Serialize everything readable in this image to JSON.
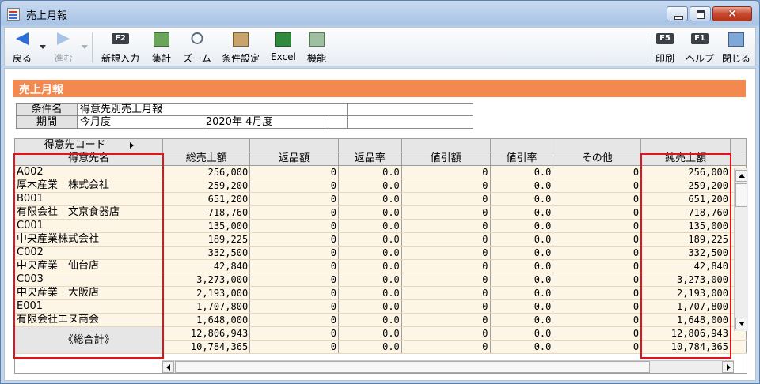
{
  "window": {
    "title": "売上月報",
    "close_label": "×"
  },
  "toolbar": {
    "back": "戻る",
    "forward": "進む",
    "new_entry": "新規入力",
    "new_entry_key": "F2",
    "aggregate": "集計",
    "zoom": "ズーム",
    "condition": "条件設定",
    "excel": "Excel",
    "features": "機能",
    "print": "印刷",
    "print_key": "F5",
    "help": "ヘルプ",
    "help_key": "F1",
    "close": "閉じる"
  },
  "section_title": "売上月報",
  "conditions": {
    "name_label": "条件名",
    "name_value": "得意先別売上月報",
    "period_label": "期間",
    "period_value": "今月度",
    "period_month": "2020年  4月度"
  },
  "grid": {
    "header_top": {
      "code": "得意先コード"
    },
    "headers": [
      "得意先名",
      "総売上額",
      "返品額",
      "返品率",
      "値引額",
      "値引率",
      "その他",
      "純売上額"
    ],
    "rows": [
      [
        "A002",
        "256,000",
        "0",
        "0.0",
        "0",
        "0.0",
        "0",
        "256,000"
      ],
      [
        "厚木産業　株式会社",
        "259,200",
        "0",
        "0.0",
        "0",
        "0.0",
        "0",
        "259,200"
      ],
      [
        "B001",
        "651,200",
        "0",
        "0.0",
        "0",
        "0.0",
        "0",
        "651,200"
      ],
      [
        "有限会社　文京食器店",
        "718,760",
        "0",
        "0.0",
        "0",
        "0.0",
        "0",
        "718,760"
      ],
      [
        "C001",
        "135,000",
        "0",
        "0.0",
        "0",
        "0.0",
        "0",
        "135,000"
      ],
      [
        "中央産業株式会社",
        "189,225",
        "0",
        "0.0",
        "0",
        "0.0",
        "0",
        "189,225"
      ],
      [
        "C002",
        "332,500",
        "0",
        "0.0",
        "0",
        "0.0",
        "0",
        "332,500"
      ],
      [
        "中央産業　仙台店",
        "42,840",
        "0",
        "0.0",
        "0",
        "0.0",
        "0",
        "42,840"
      ],
      [
        "C003",
        "3,273,000",
        "0",
        "0.0",
        "0",
        "0.0",
        "0",
        "3,273,000"
      ],
      [
        "中央産業　大阪店",
        "2,193,000",
        "0",
        "0.0",
        "0",
        "0.0",
        "0",
        "2,193,000"
      ],
      [
        "E001",
        "1,707,800",
        "0",
        "0.0",
        "0",
        "0.0",
        "0",
        "1,707,800"
      ],
      [
        "有限会社エヌ商会",
        "1,648,000",
        "0",
        "0.0",
        "0",
        "0.0",
        "0",
        "1,648,000"
      ]
    ],
    "total_label": "《総合計》",
    "totals": [
      [
        "12,806,943",
        "0",
        "0.0",
        "0",
        "0.0",
        "0",
        "12,806,943"
      ],
      [
        "10,784,365",
        "0",
        "0.0",
        "0",
        "0.0",
        "0",
        "10,784,365"
      ]
    ]
  },
  "colors": {
    "section_bar": "#f3894f",
    "highlight": "#e0141e",
    "row_bg": "#fdf5e6"
  }
}
